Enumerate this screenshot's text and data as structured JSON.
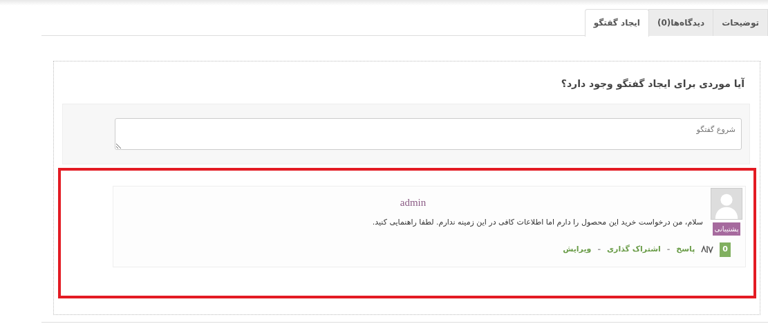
{
  "tabs": [
    {
      "label": "توضیحات",
      "selected": false
    },
    {
      "label": "دیدگاه‌ها(0)",
      "selected": false
    },
    {
      "label": "ایجاد گفتگو",
      "selected": true
    }
  ],
  "discussion": {
    "heading": "آیا موردی برای ایجاد گفتگو وجود دارد؟",
    "textarea": {
      "placeholder": "شروع گفتگو"
    }
  },
  "comment": {
    "highlighted": true,
    "author": "admin",
    "badge": "پشتیبانی",
    "text": "سلام، من درخواست خرید این محصول را دارم اما اطلاعات کافی در این زمینه ندارم. لطفا راهنمایی کنید.",
    "votes": "0",
    "actions": [
      {
        "kind": "link",
        "label": "پاسخ"
      },
      {
        "kind": "separator",
        "label": "-"
      },
      {
        "kind": "link",
        "label": "اشتراک گذاری"
      },
      {
        "kind": "separator",
        "label": "-"
      },
      {
        "kind": "link",
        "label": "ویرایش"
      }
    ]
  }
}
